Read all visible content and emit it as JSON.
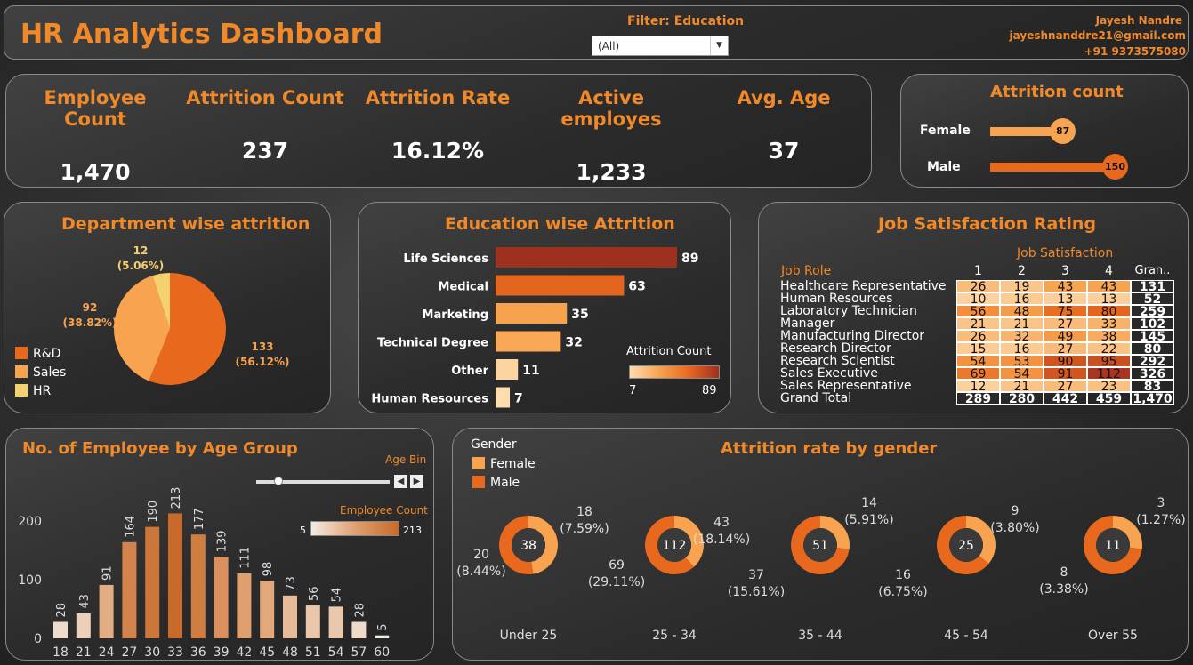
{
  "header": {
    "title": "HR Analytics Dashboard",
    "filter_label": "Filter: Education",
    "filter_value": "(All)",
    "author_name": "Jayesh Nandre",
    "author_email": "jayeshnanddre21@gmail.com",
    "author_phone": "+91 9373575080"
  },
  "kpis": [
    {
      "label": "Employee Count",
      "value": "1,470"
    },
    {
      "label": "Attrition Count",
      "value": "237"
    },
    {
      "label": "Attrition Rate",
      "value": "16.12%"
    },
    {
      "label": "Active employes",
      "value": "1,233"
    },
    {
      "label": "Avg. Age",
      "value": "37"
    }
  ],
  "colors": {
    "accent": "#f0892a",
    "dark_orange": "#e8681e",
    "light_orange": "#f7a34f",
    "yellow": "#f5d06e"
  },
  "gender_attrition": {
    "title": "Attrition count",
    "rows": [
      {
        "label": "Female",
        "value": 87,
        "display": "87"
      },
      {
        "label": "Male",
        "value": 150,
        "display": "150"
      }
    ]
  },
  "department": {
    "title": "Department wise attrition",
    "legend": [
      "R&D",
      "Sales",
      "HR"
    ],
    "slices": [
      {
        "name": "R&D",
        "value": 133,
        "label": "133",
        "pct": "(56.12%)",
        "color": "#e8681e"
      },
      {
        "name": "Sales",
        "value": 92,
        "label": "92",
        "pct": "(38.82%)",
        "color": "#f7a34f"
      },
      {
        "name": "HR",
        "value": 12,
        "label": "12",
        "pct": "(5.06%)",
        "color": "#f5d06e"
      }
    ]
  },
  "education": {
    "title": "Education wise Attrition",
    "legend_title": "Attrition Count",
    "legend_min": "7",
    "legend_max": "89",
    "bars": [
      {
        "label": "Life Sciences",
        "value": 89,
        "display": "89"
      },
      {
        "label": "Medical",
        "value": 63,
        "display": "63"
      },
      {
        "label": "Marketing",
        "value": 35,
        "display": "35"
      },
      {
        "label": "Technical Degree",
        "value": 32,
        "display": "32"
      },
      {
        "label": "Other",
        "value": 11,
        "display": "11"
      },
      {
        "label": "Human Resources",
        "value": 7,
        "display": "7"
      }
    ]
  },
  "job_satisfaction": {
    "title": "Job Satisfaction Rating",
    "col_group": "Job Satisfaction",
    "row_header": "Job Role",
    "columns": [
      "1",
      "2",
      "3",
      "4",
      "Gran.."
    ],
    "rows": [
      {
        "role": "Healthcare Representative",
        "v": [
          26,
          19,
          43,
          43
        ],
        "total": "131"
      },
      {
        "role": "Human Resources",
        "v": [
          10,
          16,
          13,
          13
        ],
        "total": "52"
      },
      {
        "role": "Laboratory Technician",
        "v": [
          56,
          48,
          75,
          80
        ],
        "total": "259"
      },
      {
        "role": "Manager",
        "v": [
          21,
          21,
          27,
          33
        ],
        "total": "102"
      },
      {
        "role": "Manufacturing Director",
        "v": [
          26,
          32,
          49,
          38
        ],
        "total": "145"
      },
      {
        "role": "Research Director",
        "v": [
          15,
          16,
          27,
          22
        ],
        "total": "80"
      },
      {
        "role": "Research Scientist",
        "v": [
          54,
          53,
          90,
          95
        ],
        "total": "292"
      },
      {
        "role": "Sales Executive",
        "v": [
          69,
          54,
          91,
          112
        ],
        "total": "326"
      },
      {
        "role": "Sales Representative",
        "v": [
          12,
          21,
          27,
          23
        ],
        "total": "83"
      }
    ],
    "grand_total": {
      "role": "Grand Total",
      "v": [
        "289",
        "280",
        "442",
        "459"
      ],
      "total": "1,470"
    }
  },
  "chart_data": [
    {
      "type": "bar",
      "title": "No. of Employee by Age Group",
      "legend_title": "Employee Count",
      "legend_min": "5",
      "legend_max": "213",
      "slider_label": "Age Bin",
      "categories": [
        "18",
        "21",
        "24",
        "27",
        "30",
        "33",
        "36",
        "39",
        "42",
        "45",
        "48",
        "51",
        "54",
        "57",
        "60"
      ],
      "values": [
        28,
        43,
        91,
        164,
        190,
        213,
        177,
        139,
        111,
        98,
        73,
        56,
        54,
        28,
        5
      ],
      "y_ticks": [
        "0",
        "100",
        "200"
      ],
      "ylim": [
        0,
        230
      ]
    },
    {
      "type": "pie",
      "title": "Attrition rate by gender",
      "legend_title": "Gender",
      "legend": [
        {
          "name": "Female",
          "color": "#f7a34f"
        },
        {
          "name": "Male",
          "color": "#e8681e"
        }
      ],
      "groups": [
        {
          "name": "Under 25",
          "center": "38",
          "female": 18,
          "male": 20,
          "female_label": "18",
          "female_pct": "(7.59%)",
          "male_label": "20",
          "male_pct": "(8.44%)"
        },
        {
          "name": "25 - 34",
          "center": "112",
          "female": 43,
          "male": 69,
          "female_label": "43",
          "female_pct": "(18.14%)",
          "male_label": "69",
          "male_pct": "(29.11%)"
        },
        {
          "name": "35 - 44",
          "center": "51",
          "female": 14,
          "male": 37,
          "female_label": "14",
          "female_pct": "(5.91%)",
          "male_label": "37",
          "male_pct": "(15.61%)"
        },
        {
          "name": "45 - 54",
          "center": "25",
          "female": 9,
          "male": 16,
          "female_label": "9",
          "female_pct": "(3.80%)",
          "male_label": "16",
          "male_pct": "(6.75%)"
        },
        {
          "name": "Over 55",
          "center": "11",
          "female": 3,
          "male": 8,
          "female_label": "3",
          "female_pct": "(1.27%)",
          "male_label": "8",
          "male_pct": "(3.38%)"
        }
      ]
    }
  ]
}
